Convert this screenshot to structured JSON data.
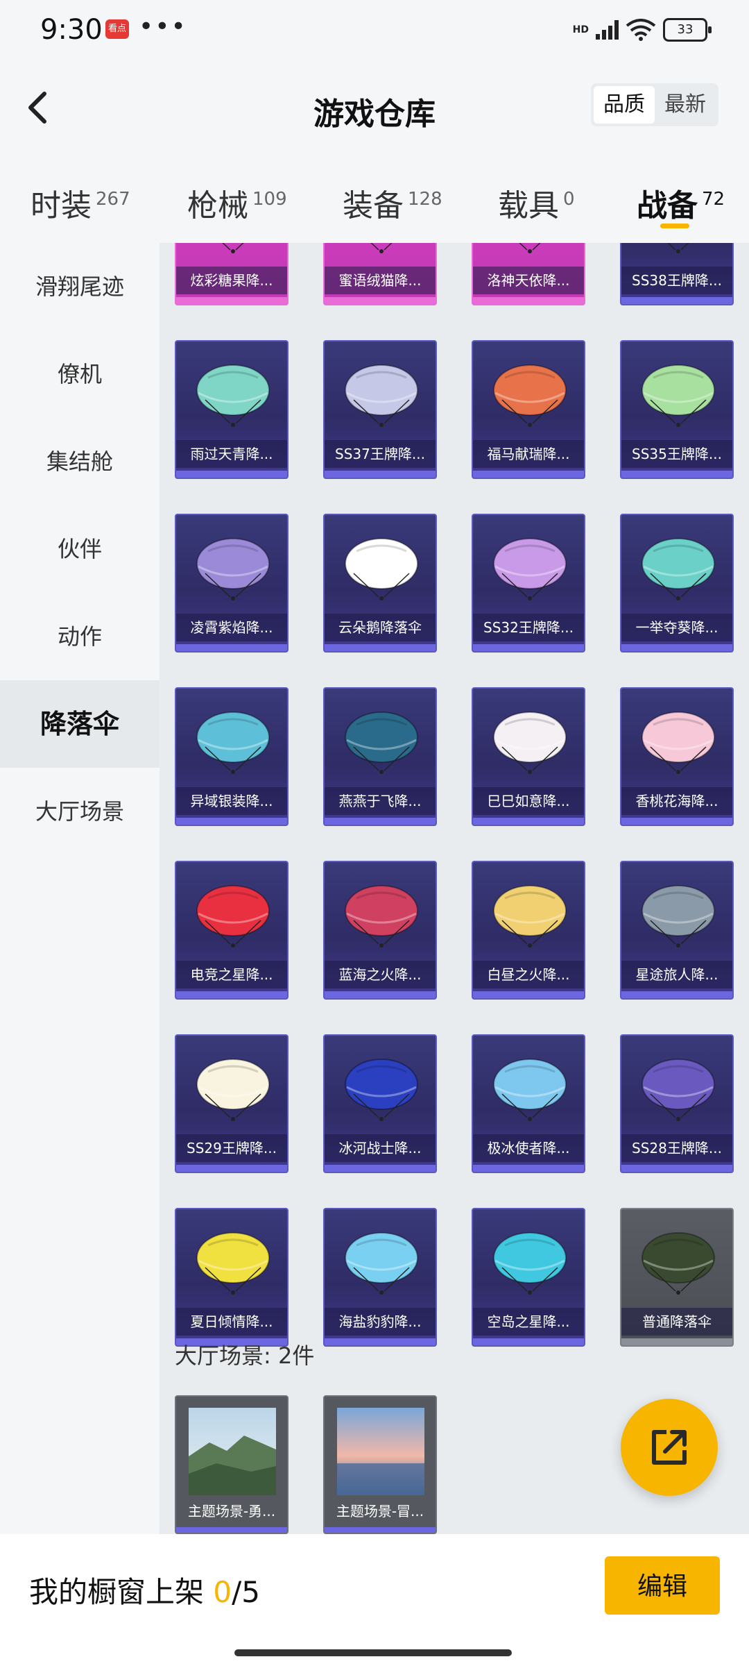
{
  "status": {
    "time": "9:30",
    "app_badge": "看点",
    "more": "•••",
    "network": "HD",
    "battery": "33"
  },
  "header": {
    "title": "游戏仓库",
    "sort_options": [
      "品质",
      "最新"
    ],
    "active_sort": "品质"
  },
  "tabs": [
    {
      "label": "时装",
      "count": "267"
    },
    {
      "label": "枪械",
      "count": "109"
    },
    {
      "label": "装备",
      "count": "128"
    },
    {
      "label": "载具",
      "count": "0"
    },
    {
      "label": "战备",
      "count": "72"
    }
  ],
  "active_tab": "战备",
  "sidebar": [
    {
      "label": "滑翔尾迹"
    },
    {
      "label": "僚机"
    },
    {
      "label": "集结舱"
    },
    {
      "label": "伙伴"
    },
    {
      "label": "动作"
    },
    {
      "label": "降落伞"
    },
    {
      "label": "大厅场景"
    }
  ],
  "active_sidebar": "降落伞",
  "items": [
    {
      "name": "炫彩糖果降...",
      "rarity": "pink"
    },
    {
      "name": "蜜语绒猫降...",
      "rarity": "pink"
    },
    {
      "name": "洛神天依降...",
      "rarity": "pink"
    },
    {
      "name": "SS38王牌降...",
      "rarity": "purple"
    },
    {
      "name": "雨过天青降...",
      "rarity": "purple"
    },
    {
      "name": "SS37王牌降...",
      "rarity": "purple"
    },
    {
      "name": "福马献瑞降...",
      "rarity": "purple"
    },
    {
      "name": "SS35王牌降...",
      "rarity": "purple"
    },
    {
      "name": "凌霄紫焰降...",
      "rarity": "purple"
    },
    {
      "name": "云朵鹅降落伞",
      "rarity": "purple"
    },
    {
      "name": "SS32王牌降...",
      "rarity": "purple"
    },
    {
      "name": "一举夺葵降...",
      "rarity": "purple"
    },
    {
      "name": "异域银装降...",
      "rarity": "purple"
    },
    {
      "name": "燕燕于飞降...",
      "rarity": "purple"
    },
    {
      "name": "巳巳如意降...",
      "rarity": "purple"
    },
    {
      "name": "香桃花海降...",
      "rarity": "purple"
    },
    {
      "name": "电竞之星降...",
      "rarity": "purple"
    },
    {
      "name": "蓝海之火降...",
      "rarity": "purple"
    },
    {
      "name": "白昼之火降...",
      "rarity": "purple"
    },
    {
      "name": "星途旅人降...",
      "rarity": "purple"
    },
    {
      "name": "SS29王牌降...",
      "rarity": "purple"
    },
    {
      "name": "冰河战士降...",
      "rarity": "purple"
    },
    {
      "name": "极冰使者降...",
      "rarity": "purple"
    },
    {
      "name": "SS28王牌降...",
      "rarity": "purple"
    },
    {
      "name": "夏日倾情降...",
      "rarity": "purple"
    },
    {
      "name": "海盐豹豹降...",
      "rarity": "purple"
    },
    {
      "name": "空岛之星降...",
      "rarity": "purple"
    },
    {
      "name": "普通降落伞",
      "rarity": "gray"
    }
  ],
  "chute_colors": [
    "#e9a0d8",
    "#f0c0e8",
    "#e8b0f0",
    "#5a4fcf",
    "#7fd6c6",
    "#c6c8e8",
    "#e8724a",
    "#a8e0a0",
    "#9a8ad8",
    "#ffffff",
    "#c89ae8",
    "#6ad0c8",
    "#5ec0d8",
    "#2a6a8a",
    "#f4f0f4",
    "#f6c8d8",
    "#e83040",
    "#d04060",
    "#f0d070",
    "#8a9aa8",
    "#f8f4e0",
    "#2a40c0",
    "#7ec8f0",
    "#6a5ac0",
    "#f0e040",
    "#7ad0f0",
    "#40c8e0",
    "#3a4a30"
  ],
  "scenes_section": {
    "title": "大厅场景: 2件"
  },
  "scenes": [
    {
      "name": "主题场景-勇..."
    },
    {
      "name": "主题场景-冒..."
    }
  ],
  "bottom": {
    "showcase_label": "我的橱窗上架",
    "showcase_count": "0",
    "showcase_total": "/5",
    "edit_label": "编辑"
  },
  "accent": "#f7b500"
}
